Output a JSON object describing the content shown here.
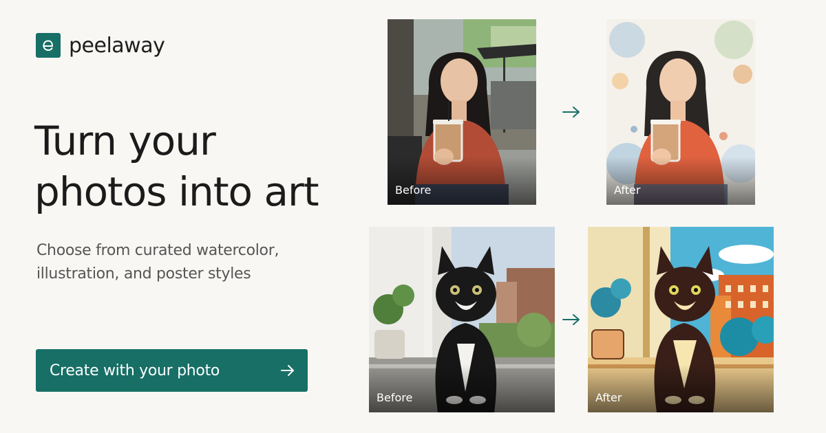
{
  "brand": {
    "name": "peelaway",
    "accent": "#176f66"
  },
  "hero": {
    "headline": [
      "Turn your",
      "photos into art"
    ],
    "subhead": [
      "Choose from curated watercolor,",
      "illustration, and poster styles"
    ]
  },
  "cta": {
    "label": "Create with your photo",
    "icon": "arrow-right-icon"
  },
  "examples": [
    {
      "before_label": "Before",
      "after_label": "After"
    },
    {
      "before_label": "Before",
      "after_label": "After"
    }
  ]
}
